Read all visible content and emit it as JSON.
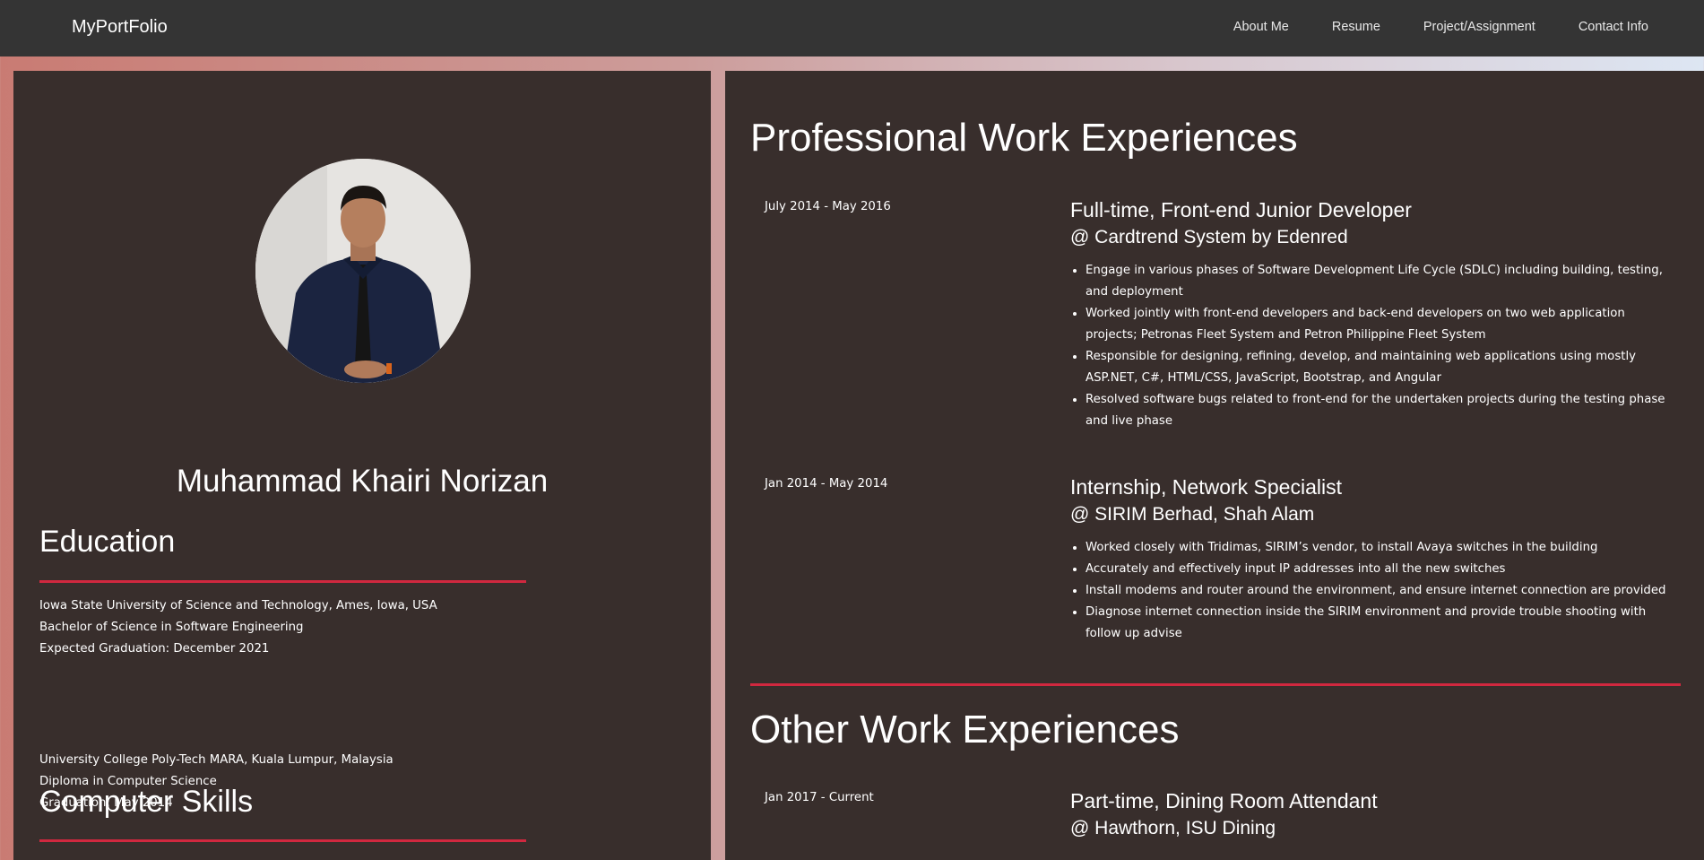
{
  "nav": {
    "brand": "MyPortFolio",
    "links": [
      "About Me",
      "Resume",
      "Project/Assignment",
      "Contact Info"
    ]
  },
  "profile": {
    "name": "Muhammad Khairi Norizan"
  },
  "education": {
    "heading": "Education",
    "entries": [
      {
        "school": "Iowa State University of Science and Technology, Ames, Iowa, USA",
        "degree": "Bachelor of Science in Software Engineering",
        "graduation": "Expected Graduation: December 2021"
      },
      {
        "school": "University College Poly-Tech MARA, Kuala Lumpur, Malaysia",
        "degree": "Diploma in Computer Science",
        "graduation": "Graduation: May 2014"
      }
    ]
  },
  "skills": {
    "heading": "Computer Skills"
  },
  "professional": {
    "heading": "Professional Work Experiences",
    "jobs": [
      {
        "date": "July 2014 - May 2016",
        "title": "Full-time, Front-end Junior Developer",
        "company": "@ Cardtrend System by Edenred",
        "bullets": [
          "Engage in various phases of Software Development Life Cycle (SDLC) including building, testing, and deployment",
          "Worked jointly with front-end developers and back-end developers on two web application projects; Petronas Fleet System and Petron Philippine Fleet System",
          "Responsible for designing, refining, develop, and maintaining web applications using mostly ASP.NET, C#, HTML/CSS, JavaScript, Bootstrap, and Angular",
          "Resolved software bugs related to front-end for the undertaken projects during the testing phase and live phase"
        ]
      },
      {
        "date": "Jan 2014 - May 2014",
        "title": "Internship, Network Specialist",
        "company": "@ SIRIM Berhad, Shah Alam",
        "bullets": [
          "Worked closely with Tridimas, SIRIM’s vendor, to install Avaya switches in the building",
          "Accurately and effectively input IP addresses into all the new switches",
          "Install modems and router around the environment, and ensure internet connection are provided",
          "Diagnose internet connection inside the SIRIM environment and provide trouble shooting with follow up advise"
        ]
      }
    ]
  },
  "other": {
    "heading": "Other Work Experiences",
    "jobs": [
      {
        "date": "Jan 2017 - Current",
        "title": "Part-time, Dining Room Attendant",
        "company": "@ Hawthorn, ISU Dining"
      }
    ]
  },
  "colors": {
    "navbar": "#343434",
    "panel": "#382e2c",
    "accent_rule": "#d0283f"
  }
}
